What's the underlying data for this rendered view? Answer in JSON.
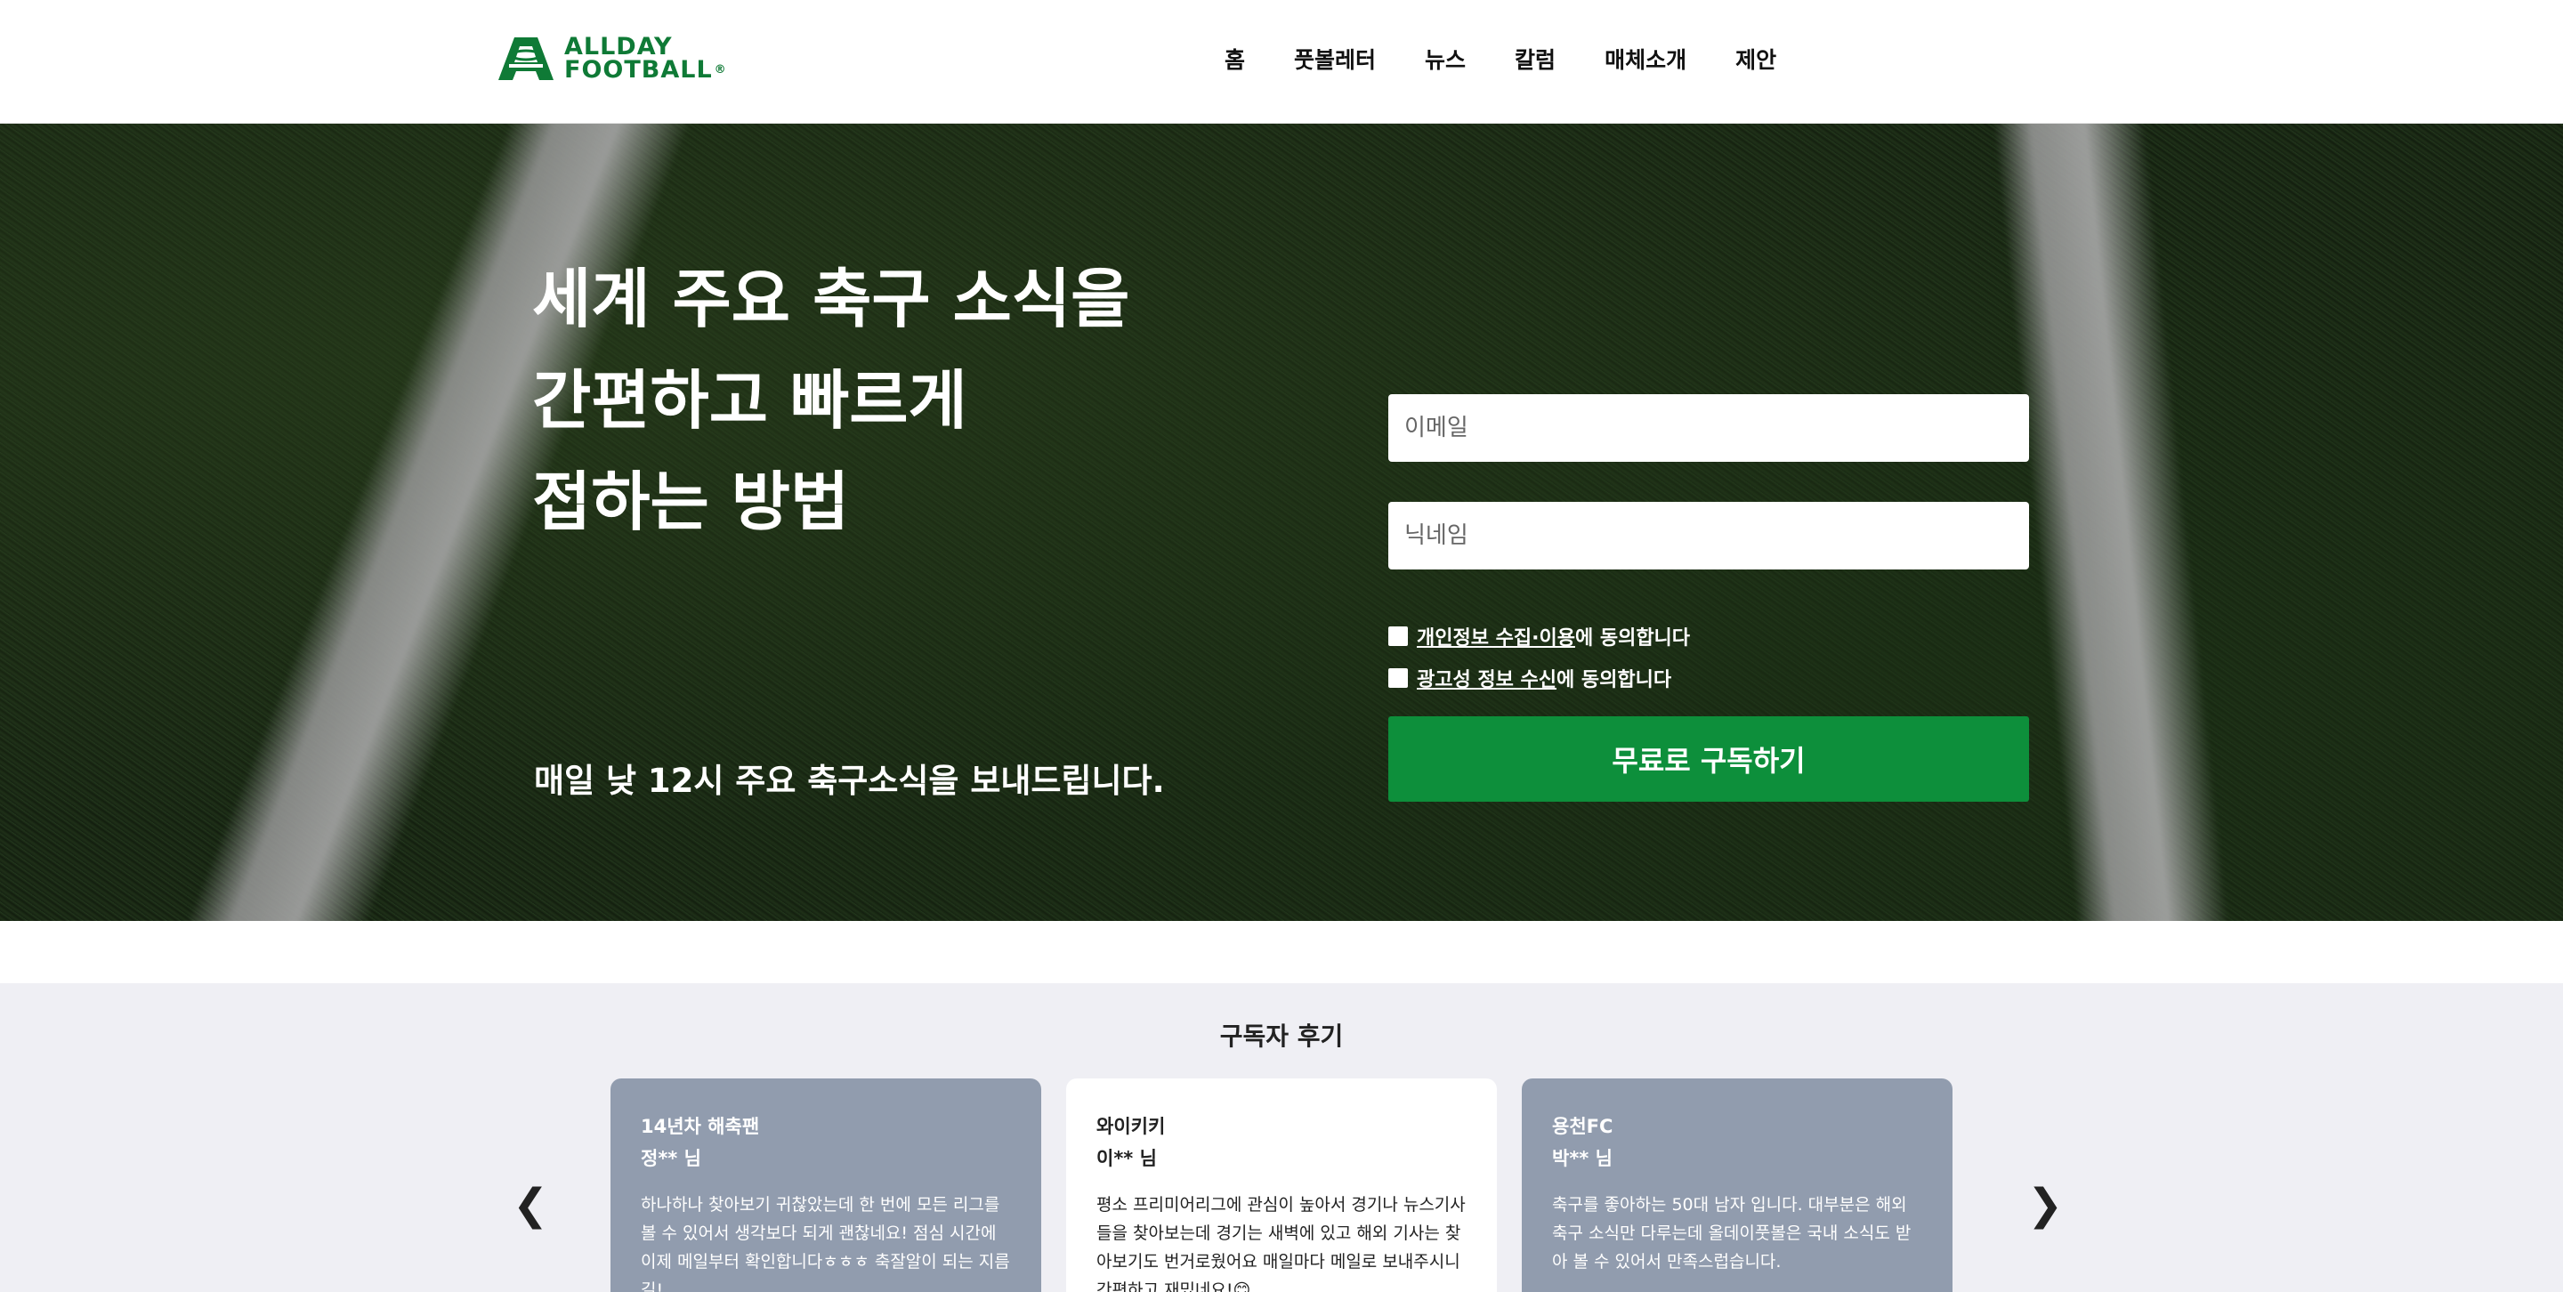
{
  "header": {
    "logo": {
      "line1": "ALLDAY",
      "line2": "FOOTBALL",
      "reg": "®"
    },
    "nav": [
      {
        "label": "홈"
      },
      {
        "label": "풋볼레터"
      },
      {
        "label": "뉴스"
      },
      {
        "label": "칼럼"
      },
      {
        "label": "매체소개"
      },
      {
        "label": "제안"
      }
    ]
  },
  "hero": {
    "headline": [
      "세계 주요 축구 소식을",
      "간편하고 빠르게",
      "접하는 방법"
    ],
    "subline": "매일 낮 12시 주요 축구소식을 보내드립니다.",
    "email_placeholder": "이메일",
    "nickname_placeholder": "닉네임",
    "consent_privacy_link": "개인정보 수집·이용",
    "consent_privacy_suffix": "에 동의합니다",
    "consent_ads_link": "광고성 정보 수신",
    "consent_ads_suffix": "에 동의합니다",
    "subscribe_label": "무료로 구독하기"
  },
  "reviews": {
    "title": "구독자 후기",
    "prev": "❮",
    "next": "❯",
    "cards": [
      {
        "team": "14년차 해축팬",
        "user": "정** 님",
        "text": "하나하나 찾아보기 귀찮았는데 한 번에 모든 리그를 볼 수 있어서 생각보다 되게 괜찮네요! 점심 시간에 이제 메일부터 확인합니다ㅎㅎㅎ 축잘알이 되는 지름길!"
      },
      {
        "team": "와이키키",
        "user": "이** 님",
        "text": "평소 프리미어리그에 관심이 높아서 경기나 뉴스기사들을 찾아보는데 경기는 새벽에 있고 해외 기사는 찾아보기도 번거로웠어요 매일마다 메일로 보내주시니 간편하고 재밌네요!😊"
      },
      {
        "team": "용천FC",
        "user": "박** 님",
        "text": "축구를 좋아하는 50대 남자 입니다. 대부분은 해외 축구 소식만 다루는데 올데이풋볼은 국내 소식도 받아 볼 수 있어서 만족스럽습니다."
      }
    ]
  },
  "colors": {
    "brand_green": "#0f7a36",
    "button_green": "#0d8f3b",
    "review_bg": "#efeff4",
    "card_gray": "#919cae"
  }
}
